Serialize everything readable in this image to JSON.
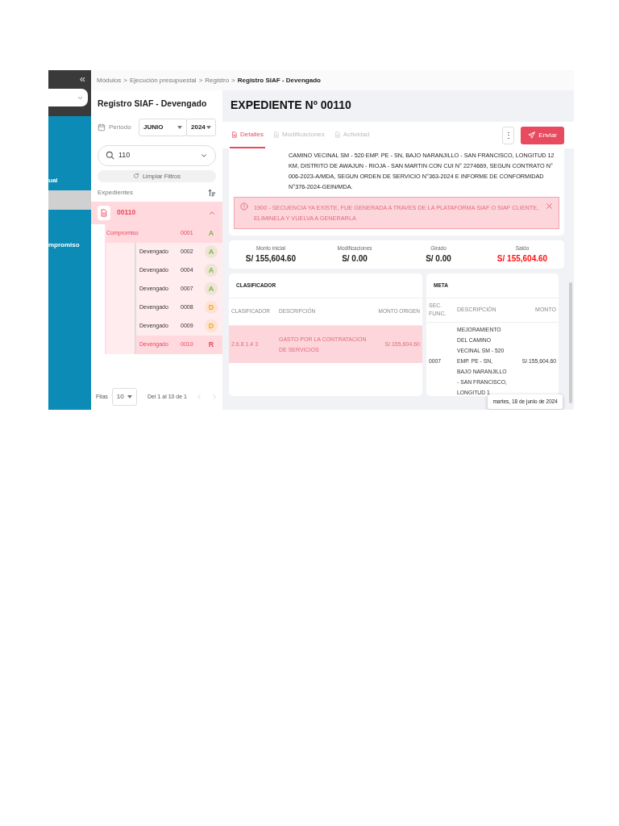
{
  "sidebar": {
    "collapse": "«",
    "menu_items": [
      {
        "label": "ual",
        "selected": false
      },
      {
        "selected": true
      },
      {
        "label": "mpromiso",
        "selected": false
      }
    ]
  },
  "breadcrumb": {
    "separator": ">",
    "items": [
      "Módulos",
      "Ejecución presupuestal",
      "Registro",
      "Registro SIAF - Devengado"
    ]
  },
  "list_panel": {
    "title": "Registro SIAF - Devengado",
    "period": {
      "label": "Periodo",
      "month": "JUNIO",
      "year": "2024"
    },
    "search": {
      "value": "110"
    },
    "clear_button": "Limpiar Filtros",
    "header": "Expedientes",
    "expediente": {
      "number": "00110",
      "expanded": true,
      "items": [
        {
          "label": "Compromiso",
          "code": "0001",
          "status": "A",
          "color": "#7cb342",
          "selected": true,
          "children": [
            {
              "label": "Devengado",
              "code": "0002",
              "status": "A",
              "color": "#7cb342",
              "selected": false
            },
            {
              "label": "Devengado",
              "code": "0004",
              "status": "A",
              "color": "#7cb342",
              "selected": false
            },
            {
              "label": "Devengado",
              "code": "0007",
              "status": "A",
              "color": "#7cb342",
              "selected": false
            },
            {
              "label": "Devengado",
              "code": "0008",
              "status": "D",
              "color": "#f5a623",
              "selected": false
            },
            {
              "label": "Devengado",
              "code": "0009",
              "status": "D",
              "color": "#f5a623",
              "selected": false
            },
            {
              "label": "Devengado",
              "code": "0010",
              "status": "R",
              "color": "#e84a5f",
              "selected": true
            }
          ]
        }
      ]
    },
    "footer": {
      "rows_label": "Filas",
      "rows": "10",
      "range": "Del 1 al 10 de 1"
    }
  },
  "main": {
    "title": "EXPEDIENTE Nº 00110",
    "tabs": [
      {
        "label": "Detalles",
        "selected": true
      },
      {
        "label": "Modificaciones",
        "selected": false
      },
      {
        "label": "Actividad",
        "selected": false
      }
    ],
    "more_button": "⋮",
    "send_button": "Enviar",
    "description": "CAMINO VECINAL SM - 520 EMP. PE - SN, BAJO NARANJILLO - SAN FRANCISCO, LONGITUD 12 KM, DISTRITO DE AWAJUN - RIOJA - SAN MARTIN CON CUI N° 2274669, SEGUN CONTRATO N° 006-2023-A/MDA, SEGUN ORDEN DE SERVICIO N°363-2024 E INFORME DE CONFORMIDAD N°376-2024-GEIN/MDA.",
    "alert": "1900 - SECUENCIA YA EXISTE, FUE GENERADA A TRAVES DE LA PLATAFORMA SIAF O SIAF CLIENTE, ELIMINELA Y VUELVA A GENERARLA",
    "summary": [
      {
        "label": "Monto inicial",
        "value": "S/ 155,604.60",
        "alert": false
      },
      {
        "label": "Modificaciones",
        "value": "S/ 0.00",
        "alert": false
      },
      {
        "label": "Girado",
        "value": "S/ 0.00",
        "alert": false
      },
      {
        "label": "Saldo",
        "value": "S/ 155,604.60",
        "alert": true
      }
    ],
    "clasificador": {
      "title": "CLASIFICADOR",
      "columns": [
        "CLASIFICADOR",
        "DESCRIPCIÓN",
        "MONTO ORIGEN"
      ],
      "rows": [
        {
          "cells": [
            "2.6.8 1.4 3",
            "GASTO POR LA CONTRATACION DE SERVICIOS",
            "S/.155,604.60"
          ],
          "selected": true
        }
      ]
    },
    "meta": {
      "title": "META",
      "columns": [
        "SEC. FUNC.",
        "DESCRIPCIÓN",
        "MONTO"
      ],
      "rows": [
        {
          "cells": [
            "0007",
            "MEJORAMIENTO DEL CAMINO VECINAL SM - 520 EMP. PE - SN, BAJO NARANJILLO - SAN FRANCISCO, LONGITUD 1",
            "S/.155,604.60"
          ],
          "selected": false
        }
      ]
    },
    "tooltip": "martes, 18 de junio de 2024"
  }
}
